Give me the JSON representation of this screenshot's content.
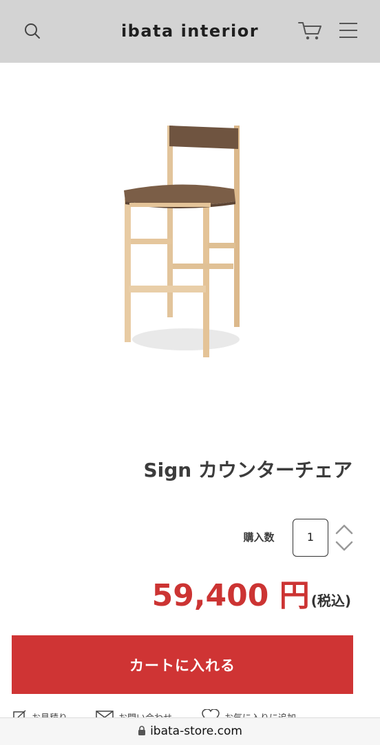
{
  "header": {
    "logo_text": "ibata interior",
    "search_icon": "search-icon",
    "cart_icon": "cart-icon",
    "menu_icon": "hamburger-menu-icon"
  },
  "product": {
    "image": "bar-stool-chair-image",
    "title": "Sign カウンターチェア",
    "quantity_label": "購入数",
    "quantity_value": "1",
    "price": "59,400 円",
    "tax_note": "(税込)",
    "add_to_cart_label": "カートに入れる"
  },
  "sub_links": [
    {
      "icon": "pencil-icon",
      "label": "お見積り"
    },
    {
      "icon": "mail-icon",
      "label": "お問い合わせ"
    },
    {
      "icon": "heart-icon",
      "label": "お気に入りに追加"
    }
  ],
  "browser": {
    "url": "ibata-store.com",
    "lock_icon": "lock-icon"
  },
  "colors": {
    "header_bg": "#d3d3d3",
    "accent_red": "#cf3434",
    "price_red": "#cc3433"
  }
}
